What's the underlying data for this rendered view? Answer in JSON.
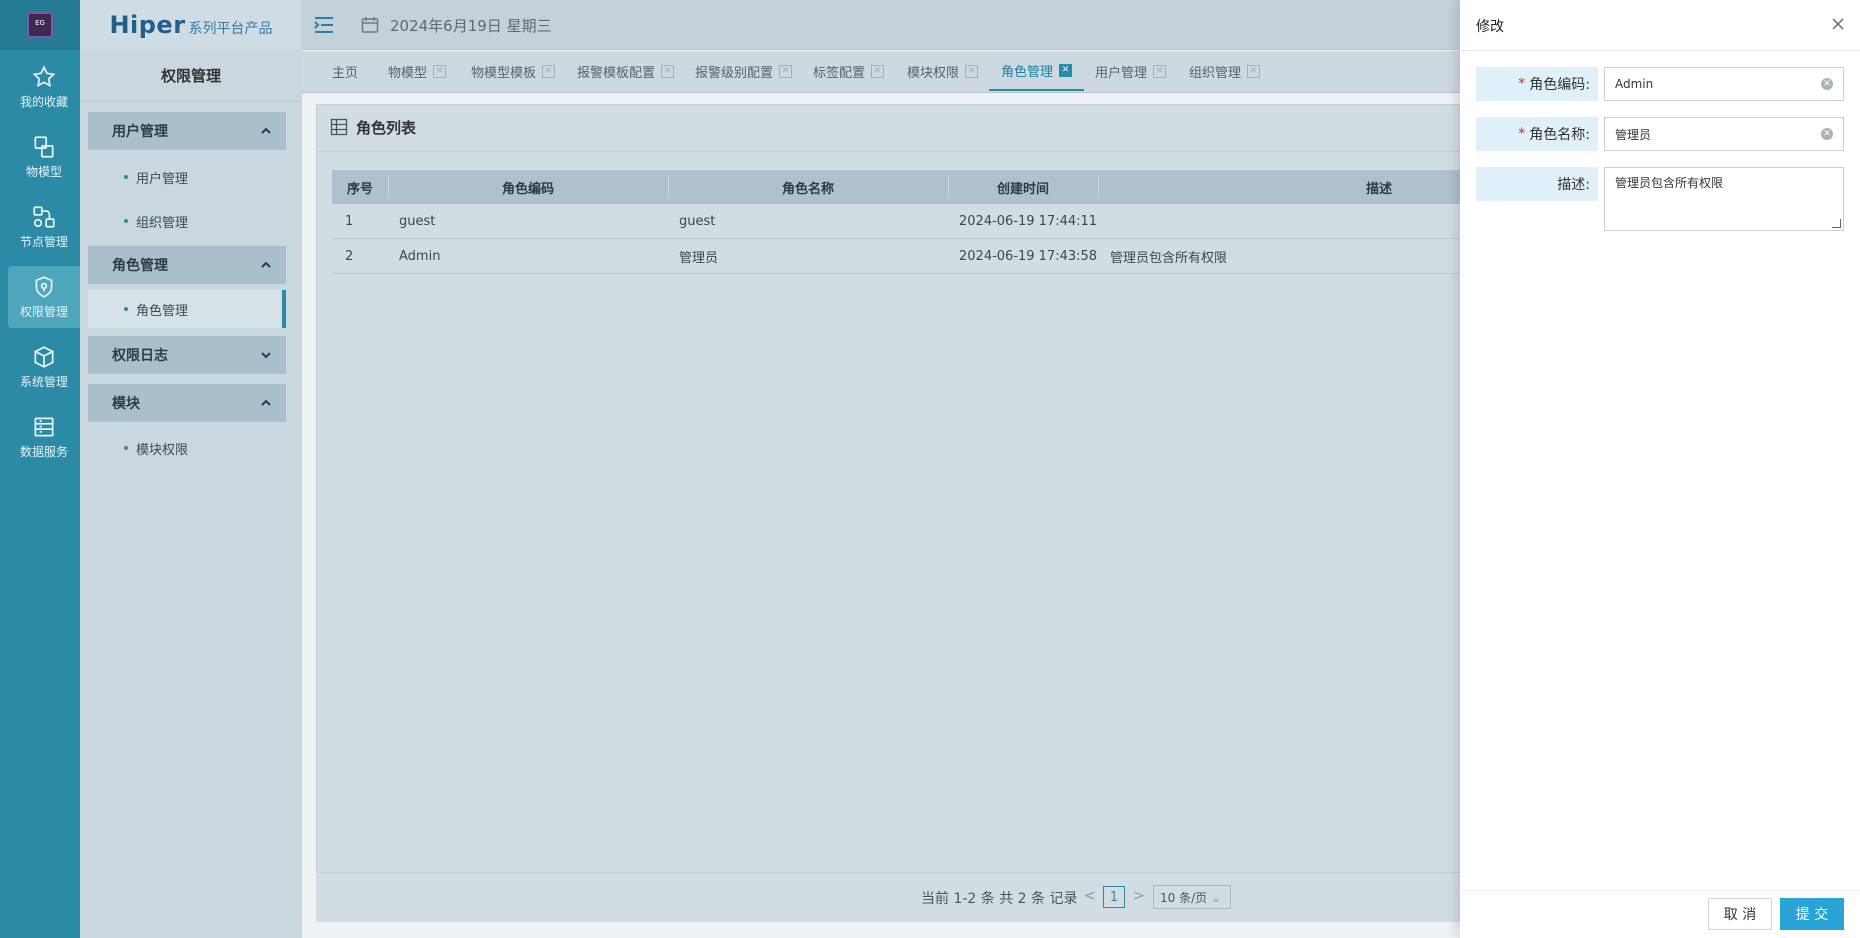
{
  "brand": {
    "main": "Hiper",
    "suffix": "系列平台产品"
  },
  "header": {
    "date": "2024年6月19日 星期三"
  },
  "rail": [
    {
      "label": "我的收藏",
      "icon": "star-icon"
    },
    {
      "label": "物模型",
      "icon": "model-icon"
    },
    {
      "label": "节点管理",
      "icon": "node-icon"
    },
    {
      "label": "权限管理",
      "icon": "shield-icon"
    },
    {
      "label": "系统管理",
      "icon": "box-icon"
    },
    {
      "label": "数据服务",
      "icon": "database-icon"
    }
  ],
  "sidebar": {
    "title": "权限管理",
    "groups": [
      {
        "label": "用户管理",
        "items": [
          "用户管理",
          "组织管理"
        ]
      },
      {
        "label": "角色管理",
        "items": [
          "角色管理"
        ]
      },
      {
        "label": "权限日志",
        "items": []
      },
      {
        "label": "模块",
        "items": [
          "模块权限"
        ]
      }
    ]
  },
  "tabs": [
    "主页",
    "物模型",
    "物模型模板",
    "报警模板配置",
    "报警级别配置",
    "标签配置",
    "模块权限",
    "角色管理",
    "用户管理",
    "组织管理"
  ],
  "panel": {
    "title": "角色列表"
  },
  "table": {
    "headers": [
      "序号",
      "角色编码",
      "角色名称",
      "创建时间",
      "描述"
    ],
    "rows": [
      [
        "1",
        "guest",
        "guest",
        "2024-06-19 17:44:11",
        ""
      ],
      [
        "2",
        "Admin",
        "管理员",
        "2024-06-19 17:43:58",
        "管理员包含所有权限"
      ]
    ]
  },
  "pagination": {
    "info": "当前 1-2 条 共 2 条 记录",
    "prev": "<",
    "page": "1",
    "next": ">",
    "page_size": "10 条/页"
  },
  "drawer": {
    "title": "修改",
    "code_label": "角色编码:",
    "code_value": "Admin",
    "name_label": "角色名称:",
    "name_value": "管理员",
    "desc_label": "描述:",
    "desc_value": "管理员包含所有权限",
    "required_mark": "*",
    "cancel_label": "取 消",
    "submit_label": "提 交"
  },
  "colors": {
    "primary": "#2b8aa6",
    "submit": "#29a4d6",
    "required": "#e02020"
  }
}
